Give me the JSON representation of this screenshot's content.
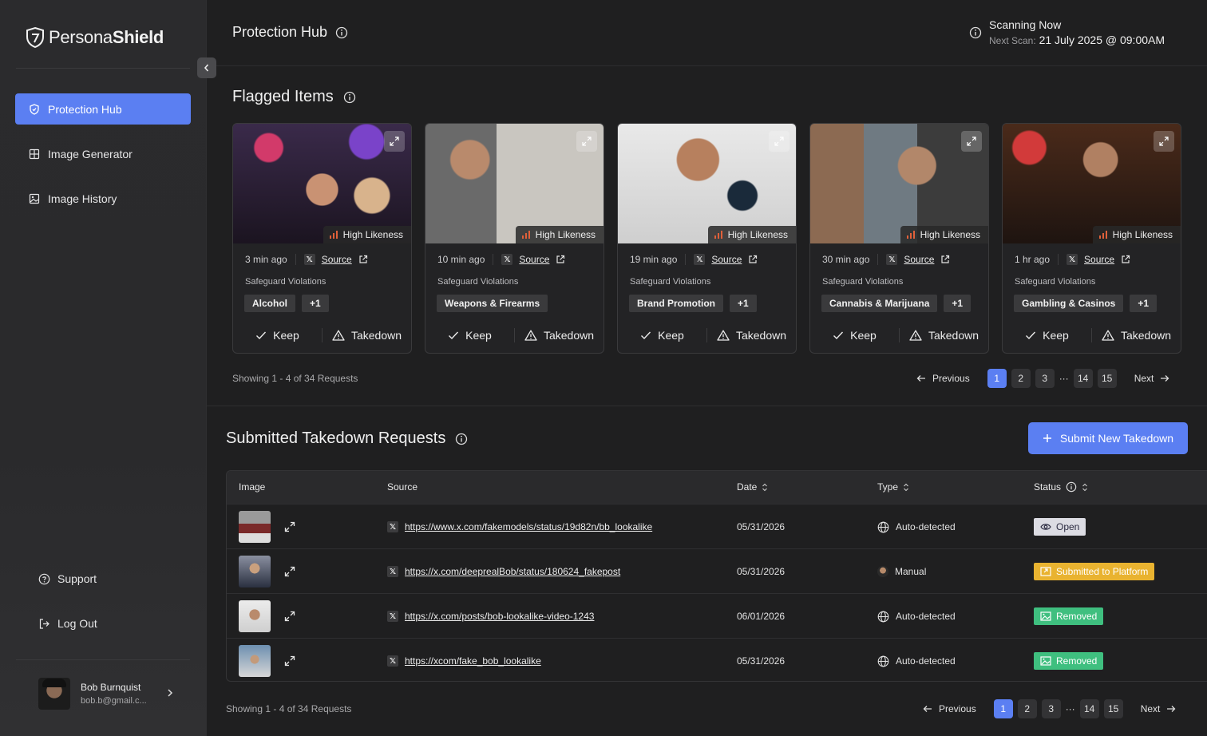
{
  "brand": {
    "name_light": "Persona",
    "name_bold": "Shield"
  },
  "sidebar": {
    "items": [
      {
        "label": "Protection Hub",
        "icon": "shield-icon",
        "active": true
      },
      {
        "label": "Image Generator",
        "icon": "grid-icon",
        "active": false
      },
      {
        "label": "Image History",
        "icon": "image-icon",
        "active": false
      }
    ],
    "support_label": "Support",
    "logout_label": "Log Out",
    "user": {
      "name": "Bob Burnquist",
      "email": "bob.b@gmail.c..."
    }
  },
  "header": {
    "title": "Protection Hub",
    "scan_status": "Scanning Now",
    "next_scan_label": "Next Scan:",
    "next_scan_value": "21 July 2025 @ 09:00AM"
  },
  "flagged": {
    "title": "Flagged Items",
    "likeness_label": "High Likeness",
    "source_label": "Source",
    "violations_label": "Safeguard Violations",
    "keep_label": "Keep",
    "takedown_label": "Takedown",
    "items": [
      {
        "time": "3 min ago",
        "violation": "Alcohol",
        "extra": "+1"
      },
      {
        "time": "10 min ago",
        "violation": "Weapons & Firearms",
        "extra": ""
      },
      {
        "time": "19 min ago",
        "violation": "Brand Promotion",
        "extra": "+1"
      },
      {
        "time": "30 min ago",
        "violation": "Cannabis & Marijuana",
        "extra": "+1"
      },
      {
        "time": "1 hr ago",
        "violation": "Gambling & Casinos",
        "extra": "+1"
      }
    ],
    "showing": "Showing 1 - 4 of 34 Requests"
  },
  "pagination": {
    "previous": "Previous",
    "next": "Next",
    "pages": [
      "1",
      "2",
      "3",
      "14",
      "15"
    ],
    "ellipsis": "···",
    "active": "1"
  },
  "takedowns": {
    "title": "Submitted Takedown Requests",
    "submit_label": "Submit New Takedown",
    "columns": {
      "image": "Image",
      "source": "Source",
      "date": "Date",
      "type": "Type",
      "status": "Status"
    },
    "rows": [
      {
        "url": "https://www.x.com/fakemodels/status/19d82n/bb_lookalike",
        "date": "05/31/2026",
        "type": "Auto-detected",
        "type_icon": "globe-icon",
        "status": "Open",
        "status_kind": "open"
      },
      {
        "url": "https://x.com/deeprealBob/status/180624_fakepost",
        "date": "05/31/2026",
        "type": "Manual",
        "type_icon": "user-avatar-icon",
        "status": "Submitted to Platform",
        "status_kind": "submitted"
      },
      {
        "url": "https://x.com/posts/bob-lookalike-video-1243",
        "date": "06/01/2026",
        "type": "Auto-detected",
        "type_icon": "globe-icon",
        "status": "Removed",
        "status_kind": "removed"
      },
      {
        "url": "https://xcom/fake_bob_lookalike",
        "date": "05/31/2026",
        "type": "Auto-detected",
        "type_icon": "globe-icon",
        "status": "Removed",
        "status_kind": "removed"
      }
    ],
    "showing": "Showing 1 - 4 of 34 Requests"
  },
  "colors": {
    "accent": "#5b7ff2",
    "open": "#dcdce3",
    "submitted": "#e9b330",
    "removed": "#3fbf7f",
    "bars": "#e0603a"
  }
}
